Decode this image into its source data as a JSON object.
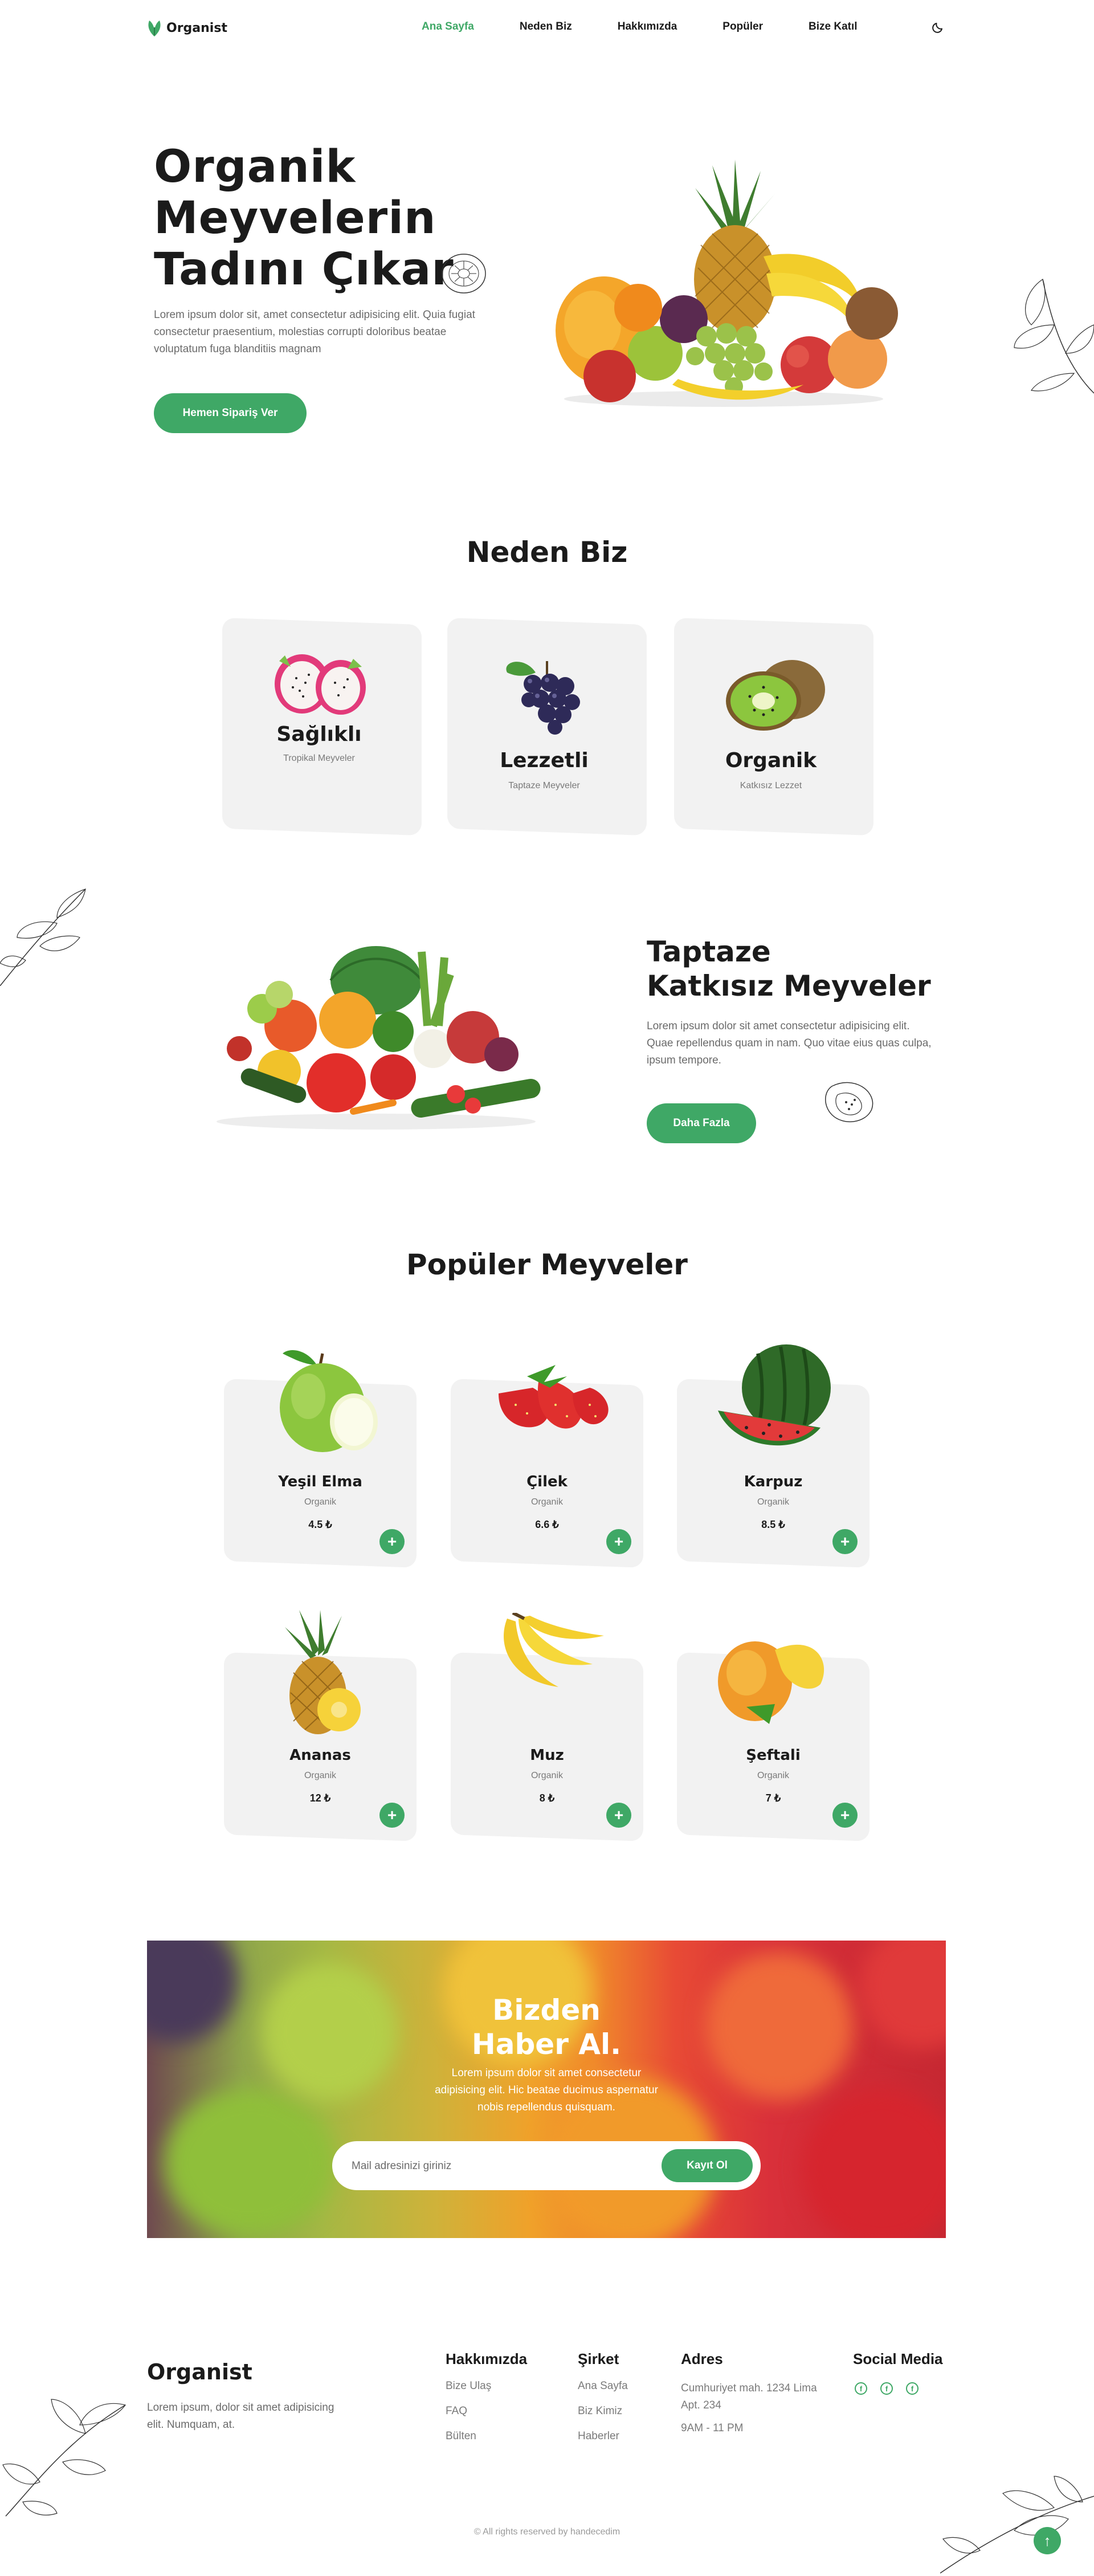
{
  "header": {
    "logo": "Organist",
    "nav": [
      "Ana Sayfa",
      "Neden Biz",
      "Hakkımızda",
      "Popüler",
      "Bize Katıl"
    ],
    "active_nav": "Ana Sayfa",
    "theme_icon": "moon-icon"
  },
  "hero": {
    "title_line1": "Organik",
    "title_line2": "Meyvelerin",
    "title_line3": "Tadını Çıkar",
    "description": "Lorem ipsum dolor sit, amet consectetur adipisicing elit. Quia fugiat consectetur praesentium, molestias corrupti doloribus beatae voluptatum fuga blanditiis magnam",
    "button": "Hemen Sipariş Ver",
    "image": "fruit-basket-image"
  },
  "why": {
    "title": "Neden Biz",
    "cards": [
      {
        "title": "Sağlıklı",
        "subtitle": "Tropikal Meyveler",
        "image": "dragonfruit-image"
      },
      {
        "title": "Lezzetli",
        "subtitle": "Taptaze Meyveler",
        "image": "grapes-image"
      },
      {
        "title": "Organik",
        "subtitle": "Katkısız Lezzet",
        "image": "kiwi-image"
      }
    ]
  },
  "fresh": {
    "title_line1": "Taptaze",
    "title_line2": "Katkısız Meyveler",
    "description": "Lorem ipsum dolor sit amet consectetur adipisicing elit. Quae repellendus quam in nam. Quo vitae eius quas culpa, ipsum tempore.",
    "button": "Daha Fazla",
    "image": "vegetables-image"
  },
  "popular": {
    "title": "Popüler Meyveler",
    "products": [
      {
        "name": "Yeşil Elma",
        "category": "Organik",
        "price": "4.5 ₺",
        "image": "green-apple-image"
      },
      {
        "name": "Çilek",
        "category": "Organik",
        "price": "6.6 ₺",
        "image": "strawberry-image"
      },
      {
        "name": "Karpuz",
        "category": "Organik",
        "price": "8.5 ₺",
        "image": "watermelon-image"
      },
      {
        "name": "Ananas",
        "category": "Organik",
        "price": "12 ₺",
        "image": "pineapple-image"
      },
      {
        "name": "Muz",
        "category": "Organik",
        "price": "8 ₺",
        "image": "banana-image"
      },
      {
        "name": "Şeftali",
        "category": "Organik",
        "price": "7 ₺",
        "image": "peach-image"
      }
    ],
    "add_icon": "plus-icon"
  },
  "newsletter": {
    "title_line1": "Bizden",
    "title_line2": "Haber Al.",
    "description": "Lorem ipsum dolor sit amet consectetur adipisicing elit. Hic beatae ducimus aspernatur nobis repellendus quisquam.",
    "placeholder": "Mail adresinizi giriniz",
    "button": "Kayıt Ol"
  },
  "footer": {
    "brand": "Organist",
    "description": "Lorem ipsum, dolor sit amet adipisicing elit. Numquam, at.",
    "columns": [
      {
        "title": "Hakkımızda",
        "links": [
          "Bize Ulaş",
          "FAQ",
          "Bülten"
        ]
      },
      {
        "title": "Şirket",
        "links": [
          "Ana Sayfa",
          "Biz Kimiz",
          "Haberler"
        ]
      },
      {
        "title": "Adres",
        "links": [
          "Cumhuriyet mah. 1234 Lima Apt. 234",
          "9AM - 11 PM"
        ]
      }
    ],
    "social_title": "Social Media",
    "social_icons": [
      "facebook-icon",
      "facebook-icon",
      "facebook-icon"
    ],
    "copyright": "© All rights reserved by handecedim"
  },
  "colors": {
    "accent": "#3fa866",
    "card_bg": "#f2f2f2",
    "text": "#1b1b1b",
    "muted": "#6b6b6b"
  }
}
